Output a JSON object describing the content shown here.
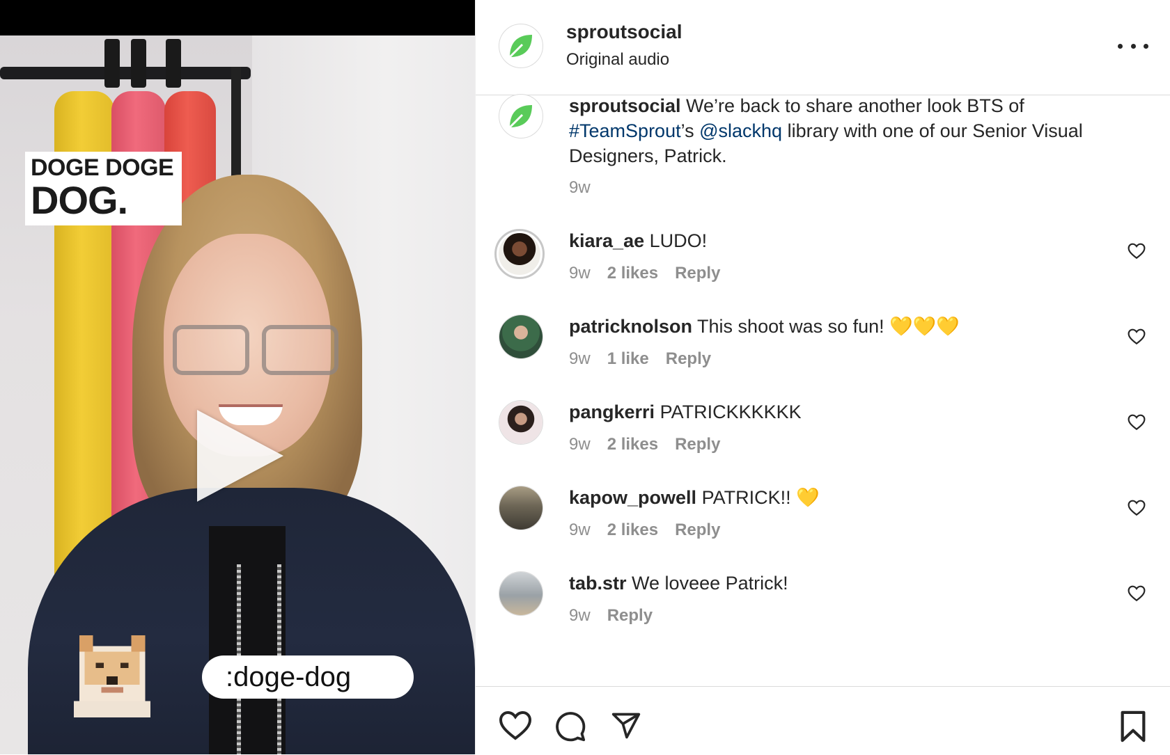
{
  "media": {
    "overlay_line1": "DOGE DOGE",
    "overlay_line2": "DOG.",
    "pill_text": ":doge-dog"
  },
  "header": {
    "username": "sproutsocial",
    "audio": "Original audio"
  },
  "caption": {
    "username": "sproutsocial",
    "text_1": " We’re back to share another look BTS of ",
    "hashtag": "#TeamSprout",
    "text_2": "’s ",
    "mention": "@slackhq",
    "text_3": " library with one of our Senior Visual Designers, Patrick.",
    "time": "9w"
  },
  "comments": [
    {
      "username": "kiara_ae",
      "text": "LUDO!",
      "time": "9w",
      "likes": "2 likes",
      "reply": "Reply"
    },
    {
      "username": "patricknolson",
      "text": "This shoot was so fun! 💛💛💛",
      "time": "9w",
      "likes": "1 like",
      "reply": "Reply"
    },
    {
      "username": "pangkerri",
      "text": "PATRICKKKKKK",
      "time": "9w",
      "likes": "2 likes",
      "reply": "Reply"
    },
    {
      "username": "kapow_powell",
      "text": "PATRICK!! 💛",
      "time": "9w",
      "likes": "2 likes",
      "reply": "Reply"
    },
    {
      "username": "tab.str",
      "text": "We loveee Patrick!",
      "time": "9w",
      "reply": "Reply"
    }
  ],
  "icons": {
    "more": "more-options-icon",
    "like": "heart-icon",
    "comment": "comment-icon",
    "share": "share-icon",
    "save": "bookmark-icon",
    "play": "play-icon"
  },
  "colors": {
    "brand_green": "#59cb59",
    "link_blue": "#00376b",
    "meta_gray": "#8e8e8e",
    "text": "#262626"
  }
}
